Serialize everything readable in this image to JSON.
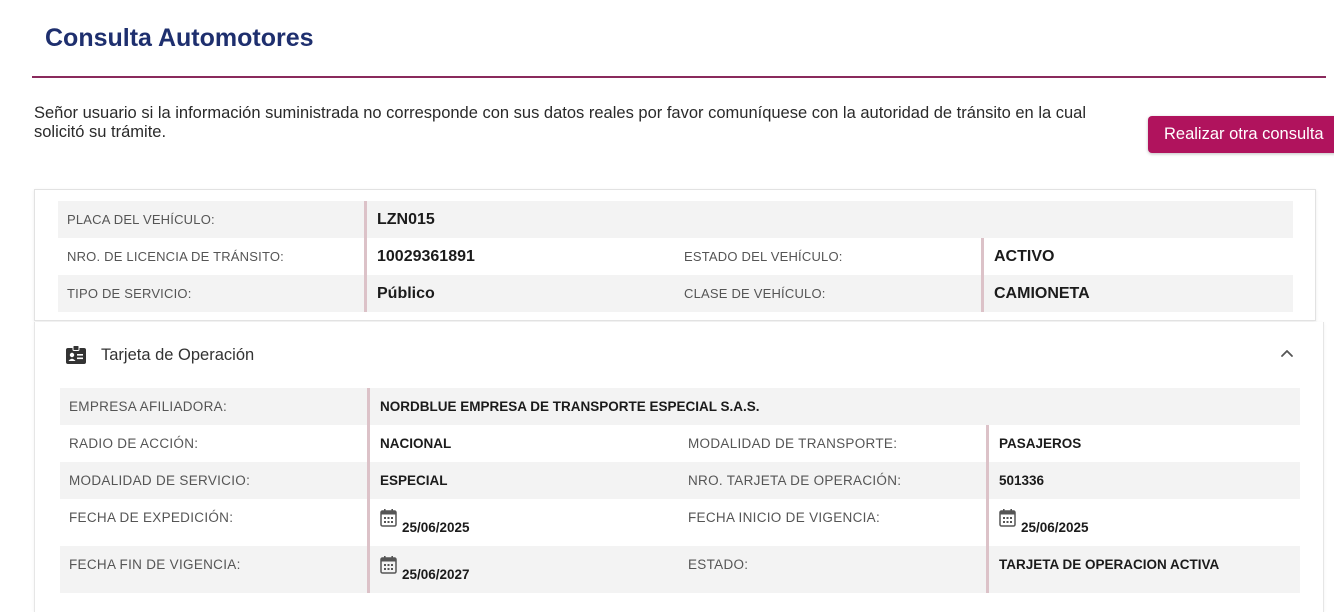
{
  "page": {
    "title": "Consulta Automotores",
    "notice": "Señor usuario si la información suministrada no corresponde con sus datos reales por favor comuníquese con la autoridad de tránsito en la cual solicitó su trámite.",
    "new_query_button": "Realizar otra consulta"
  },
  "vehicle": {
    "placa_label": "PLACA DEL VEHÍCULO:",
    "placa_value": "LZN015",
    "licencia_label": "NRO. DE LICENCIA DE TRÁNSITO:",
    "licencia_value": "10029361891",
    "estado_label": "ESTADO DEL VEHÍCULO:",
    "estado_value": "ACTIVO",
    "servicio_label": "TIPO DE SERVICIO:",
    "servicio_value": "Público",
    "clase_label": "CLASE DE VEHÍCULO:",
    "clase_value": "CAMIONETA"
  },
  "operacion": {
    "section_title": "Tarjeta de Operación",
    "section_icon": "id-card-icon",
    "toggle_icon": "chevron-up-icon",
    "empresa_label": "EMPRESA AFILIADORA:",
    "empresa_value": "NORDBLUE EMPRESA DE TRANSPORTE ESPECIAL S.A.S.",
    "radio_label": "RADIO DE ACCIÓN:",
    "radio_value": "NACIONAL",
    "modalidad_transporte_label": "MODALIDAD DE TRANSPORTE:",
    "modalidad_transporte_value": "PASAJEROS",
    "modalidad_servicio_label": "MODALIDAD DE SERVICIO:",
    "modalidad_servicio_value": "ESPECIAL",
    "nro_tarjeta_label": "NRO. TARJETA DE OPERACIÓN:",
    "nro_tarjeta_value": "501336",
    "fecha_expedicion_label": "FECHA DE EXPEDICIÓN:",
    "fecha_expedicion_value": "25/06/2025",
    "fecha_inicio_label": "FECHA INICIO DE VIGENCIA:",
    "fecha_inicio_value": "25/06/2025",
    "fecha_fin_label": "FECHA FIN DE VIGENCIA:",
    "fecha_fin_value": "25/06/2027",
    "estado_label": "ESTADO:",
    "estado_value": "TARJETA DE OPERACION ACTIVA"
  },
  "colors": {
    "title": "#1e2f6e",
    "rule": "#8a2a5c",
    "button": "#b0135d",
    "value_border": "#dcc2c8",
    "row_shade": "#f3f3f3"
  }
}
